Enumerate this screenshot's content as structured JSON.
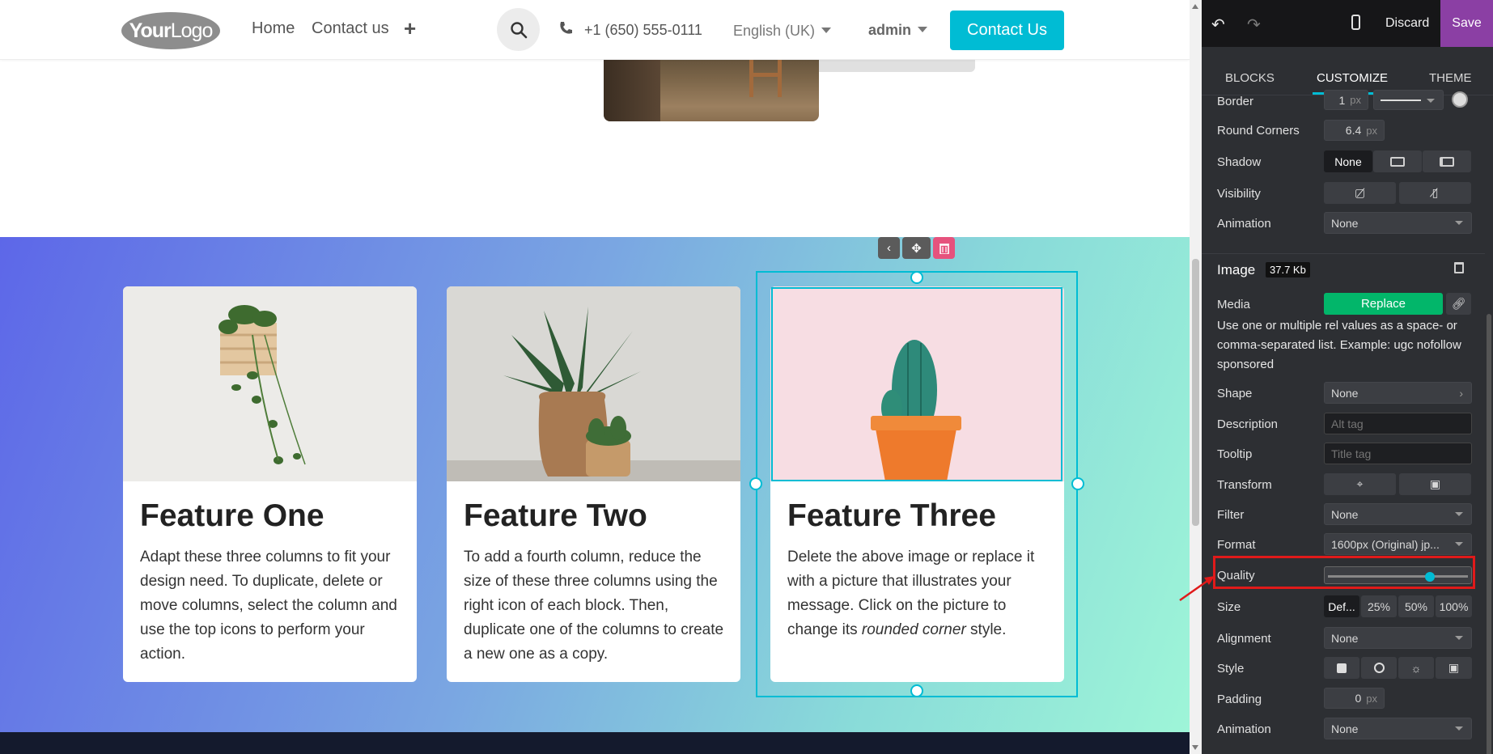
{
  "navbar": {
    "logo_text_bold": "Your",
    "logo_text": "Logo",
    "links": [
      "Home",
      "Contact us"
    ],
    "phone": "+1 (650) 555-0111",
    "language": "English (UK)",
    "user": "admin",
    "cta_label": "Contact Us"
  },
  "features": [
    {
      "title": "Feature One",
      "text": "Adapt these three columns to fit your design need. To duplicate, delete or move columns, select the column and use the top icons to perform your action."
    },
    {
      "title": "Feature Two",
      "text": "To add a fourth column, reduce the size of these three columns using the right icon of each block. Then, duplicate one of the columns to create a new one as a copy."
    },
    {
      "title": "Feature Three",
      "text_before": "Delete the above image or replace it with a picture that illustrates your message. Click on the picture to change its ",
      "text_em": "rounded corner",
      "text_after": " style."
    }
  ],
  "editor": {
    "discard_label": "Discard",
    "save_label": "Save",
    "tabs": [
      "BLOCKS",
      "CUSTOMIZE",
      "THEME"
    ],
    "active_tab": "CUSTOMIZE",
    "column_options": {
      "border_label": "Border",
      "border_value": "1",
      "unit_px": "px",
      "round_corners_label": "Round Corners",
      "round_corners_value": "6.4",
      "shadow_label": "Shadow",
      "shadow_none": "None",
      "visibility_label": "Visibility",
      "animation_label": "Animation",
      "animation_value": "None"
    },
    "image": {
      "section_title": "Image",
      "file_size": "37.7 Kb",
      "media_label": "Media",
      "replace_label": "Replace",
      "media_hint": "Use one or multiple rel values as a space- or comma-separated list. Example: ugc nofollow sponsored",
      "shape_label": "Shape",
      "shape_value": "None",
      "description_label": "Description",
      "description_placeholder": "Alt tag",
      "tooltip_label": "Tooltip",
      "tooltip_placeholder": "Title tag",
      "transform_label": "Transform",
      "filter_label": "Filter",
      "filter_value": "None",
      "format_label": "Format",
      "format_value": "1600px (Original) jp...",
      "quality_label": "Quality",
      "quality_value_fraction": 0.72,
      "size_label": "Size",
      "size_options": [
        "Def...",
        "25%",
        "50%",
        "100%"
      ],
      "alignment_label": "Alignment",
      "alignment_value": "None",
      "style_label": "Style",
      "padding_label": "Padding",
      "padding_value": "0",
      "animation_label": "Animation",
      "animation_value": "None"
    }
  },
  "colors": {
    "accent": "#00bcd4",
    "save": "#8b3fa4",
    "replace": "#02b66a",
    "highlight": "#e01a1a"
  }
}
